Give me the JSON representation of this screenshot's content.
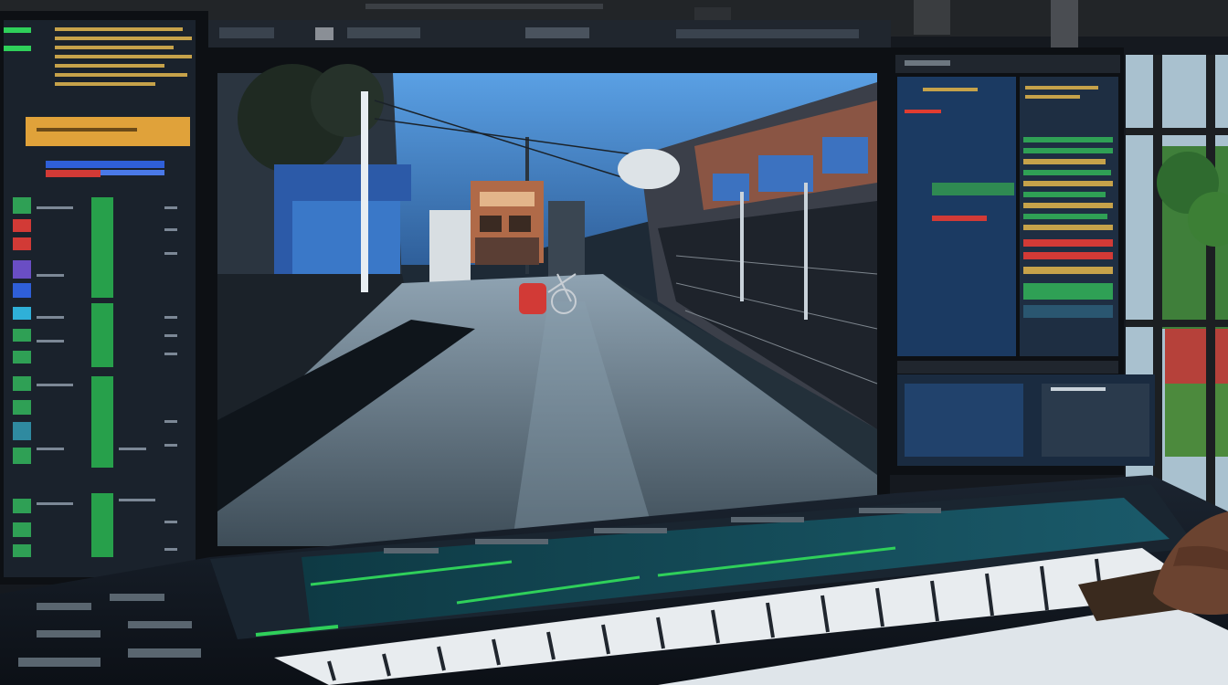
{
  "scene": {
    "palette": {
      "room_background": "#15191f",
      "monitor_bezel": "#0d1014",
      "panel_dark": "#1a222c",
      "accent_orange": "#e0a23a",
      "accent_red": "#d23a36",
      "accent_blue": "#2f5fd8",
      "accent_green": "#2fd05a",
      "screen_sky": "#3b7fc7",
      "road": "#6f8596",
      "window_greenery": "#3f7f3a",
      "desk_wood": "#3a2a1e"
    },
    "objects": [
      "left-side-monitor",
      "center-video-monitor",
      "right-side-monitor",
      "mixing-console",
      "piano-keyboard",
      "window-with-greenery",
      "hand"
    ],
    "center_screen_content": [
      "street",
      "building",
      "bicycle",
      "red-object"
    ]
  }
}
